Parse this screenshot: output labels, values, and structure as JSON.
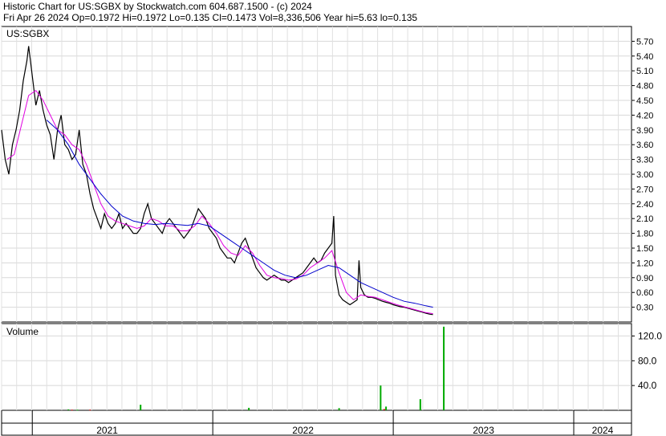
{
  "header": {
    "line1": "Historic Chart for US:SGBX by Stockwatch.com 604.687.1500 - (c) 2024",
    "line2": "Fri Apr 26 2024   Op=0.1972   Hi=0.1972   Lo=0.135   Cl=0.1473   Vol=8,336,506   Year hi=5.63   lo=0.135"
  },
  "chart_data": [
    {
      "type": "line",
      "title": "US:SGBX",
      "price_ticks": [
        5.7,
        5.4,
        5.1,
        4.8,
        4.5,
        4.2,
        3.9,
        3.6,
        3.3,
        3.0,
        2.7,
        2.4,
        2.1,
        1.8,
        1.5,
        1.2,
        0.9,
        0.6,
        0.3
      ],
      "tick_labels": [
        "5.70",
        "5.40",
        "5.10",
        "4.80",
        "4.50",
        "4.20",
        "3.90",
        "3.60",
        "3.30",
        "3.00",
        "2.70",
        "2.40",
        "2.10",
        "1.80",
        "1.50",
        "1.20",
        "0.90",
        "0.60",
        "0.30"
      ],
      "ylim": [
        0.0,
        6.0
      ],
      "x_labels": [
        "2021",
        "2022",
        "2023",
        "2024"
      ],
      "x_range": [
        2020.83,
        2024.32
      ],
      "year_boundaries": [
        2021.0,
        2022.0,
        2023.0,
        2024.0
      ],
      "grid": true,
      "series": [
        {
          "color": "#000000",
          "points": [
            [
              2020.83,
              3.9
            ],
            [
              2020.85,
              3.3
            ],
            [
              2020.87,
              3.0
            ],
            [
              2020.89,
              3.6
            ],
            [
              2020.91,
              3.9
            ],
            [
              2020.93,
              4.3
            ],
            [
              2020.95,
              4.9
            ],
            [
              2020.97,
              5.3
            ],
            [
              2020.98,
              5.6
            ],
            [
              2021.0,
              5.0
            ],
            [
              2021.02,
              4.4
            ],
            [
              2021.04,
              4.7
            ],
            [
              2021.06,
              4.3
            ],
            [
              2021.08,
              4.0
            ],
            [
              2021.1,
              3.8
            ],
            [
              2021.12,
              3.3
            ],
            [
              2021.14,
              3.9
            ],
            [
              2021.16,
              4.2
            ],
            [
              2021.18,
              3.6
            ],
            [
              2021.2,
              3.5
            ],
            [
              2021.22,
              3.3
            ],
            [
              2021.24,
              3.4
            ],
            [
              2021.26,
              3.9
            ],
            [
              2021.28,
              3.2
            ],
            [
              2021.3,
              3.0
            ],
            [
              2021.32,
              2.6
            ],
            [
              2021.34,
              2.3
            ],
            [
              2021.36,
              2.1
            ],
            [
              2021.38,
              1.9
            ],
            [
              2021.4,
              2.2
            ],
            [
              2021.42,
              2.0
            ],
            [
              2021.44,
              1.9
            ],
            [
              2021.46,
              2.0
            ],
            [
              2021.48,
              2.2
            ],
            [
              2021.5,
              1.9
            ],
            [
              2021.52,
              2.0
            ],
            [
              2021.54,
              1.9
            ],
            [
              2021.56,
              1.8
            ],
            [
              2021.58,
              1.8
            ],
            [
              2021.6,
              1.9
            ],
            [
              2021.62,
              2.2
            ],
            [
              2021.64,
              2.4
            ],
            [
              2021.66,
              2.1
            ],
            [
              2021.68,
              2.0
            ],
            [
              2021.7,
              1.9
            ],
            [
              2021.72,
              1.8
            ],
            [
              2021.74,
              2.0
            ],
            [
              2021.76,
              2.1
            ],
            [
              2021.78,
              2.0
            ],
            [
              2021.8,
              1.9
            ],
            [
              2021.82,
              1.8
            ],
            [
              2021.84,
              1.7
            ],
            [
              2021.86,
              1.8
            ],
            [
              2021.88,
              1.9
            ],
            [
              2021.9,
              2.1
            ],
            [
              2021.92,
              2.3
            ],
            [
              2021.94,
              2.2
            ],
            [
              2021.96,
              2.1
            ],
            [
              2021.98,
              1.9
            ],
            [
              2022.0,
              1.8
            ],
            [
              2022.02,
              1.7
            ],
            [
              2022.04,
              1.5
            ],
            [
              2022.06,
              1.4
            ],
            [
              2022.08,
              1.3
            ],
            [
              2022.1,
              1.3
            ],
            [
              2022.12,
              1.2
            ],
            [
              2022.14,
              1.4
            ],
            [
              2022.16,
              1.6
            ],
            [
              2022.18,
              1.7
            ],
            [
              2022.2,
              1.5
            ],
            [
              2022.22,
              1.3
            ],
            [
              2022.24,
              1.1
            ],
            [
              2022.26,
              1.0
            ],
            [
              2022.28,
              0.9
            ],
            [
              2022.3,
              0.85
            ],
            [
              2022.32,
              0.9
            ],
            [
              2022.34,
              0.95
            ],
            [
              2022.36,
              0.9
            ],
            [
              2022.38,
              0.85
            ],
            [
              2022.4,
              0.85
            ],
            [
              2022.42,
              0.8
            ],
            [
              2022.44,
              0.85
            ],
            [
              2022.46,
              0.9
            ],
            [
              2022.48,
              0.95
            ],
            [
              2022.5,
              1.0
            ],
            [
              2022.52,
              1.1
            ],
            [
              2022.54,
              1.2
            ],
            [
              2022.56,
              1.3
            ],
            [
              2022.58,
              1.2
            ],
            [
              2022.6,
              1.25
            ],
            [
              2022.62,
              1.4
            ],
            [
              2022.64,
              1.5
            ],
            [
              2022.66,
              1.6
            ],
            [
              2022.67,
              2.15
            ],
            [
              2022.68,
              0.95
            ],
            [
              2022.7,
              0.55
            ],
            [
              2022.72,
              0.45
            ],
            [
              2022.74,
              0.4
            ],
            [
              2022.76,
              0.35
            ],
            [
              2022.78,
              0.4
            ],
            [
              2022.8,
              0.45
            ],
            [
              2022.81,
              1.25
            ],
            [
              2022.82,
              0.7
            ],
            [
              2022.84,
              0.55
            ],
            [
              2022.86,
              0.5
            ],
            [
              2022.88,
              0.5
            ],
            [
              2022.9,
              0.48
            ],
            [
              2022.92,
              0.45
            ],
            [
              2022.94,
              0.42
            ],
            [
              2022.96,
              0.4
            ],
            [
              2022.98,
              0.38
            ],
            [
              2023.0,
              0.35
            ],
            [
              2023.02,
              0.33
            ],
            [
              2023.04,
              0.31
            ],
            [
              2023.06,
              0.3
            ],
            [
              2023.08,
              0.28
            ],
            [
              2023.1,
              0.26
            ],
            [
              2023.12,
              0.24
            ],
            [
              2023.14,
              0.22
            ],
            [
              2023.16,
              0.2
            ],
            [
              2023.18,
              0.18
            ],
            [
              2023.2,
              0.16
            ],
            [
              2023.22,
              0.15
            ]
          ]
        },
        {
          "color": "#e000e0",
          "points": [
            [
              2020.86,
              3.3
            ],
            [
              2020.9,
              3.4
            ],
            [
              2020.94,
              4.0
            ],
            [
              2020.98,
              4.6
            ],
            [
              2021.02,
              4.7
            ],
            [
              2021.06,
              4.5
            ],
            [
              2021.1,
              4.2
            ],
            [
              2021.14,
              3.9
            ],
            [
              2021.18,
              3.8
            ],
            [
              2021.22,
              3.6
            ],
            [
              2021.26,
              3.5
            ],
            [
              2021.3,
              3.2
            ],
            [
              2021.34,
              2.8
            ],
            [
              2021.38,
              2.4
            ],
            [
              2021.42,
              2.15
            ],
            [
              2021.46,
              2.05
            ],
            [
              2021.5,
              2.0
            ],
            [
              2021.54,
              1.95
            ],
            [
              2021.58,
              1.9
            ],
            [
              2021.62,
              1.95
            ],
            [
              2021.66,
              2.1
            ],
            [
              2021.7,
              2.05
            ],
            [
              2021.74,
              1.95
            ],
            [
              2021.78,
              1.95
            ],
            [
              2021.82,
              1.85
            ],
            [
              2021.86,
              1.85
            ],
            [
              2021.9,
              1.95
            ],
            [
              2021.94,
              2.15
            ],
            [
              2021.98,
              2.0
            ],
            [
              2022.02,
              1.8
            ],
            [
              2022.06,
              1.55
            ],
            [
              2022.1,
              1.4
            ],
            [
              2022.14,
              1.35
            ],
            [
              2022.18,
              1.55
            ],
            [
              2022.22,
              1.4
            ],
            [
              2022.26,
              1.15
            ],
            [
              2022.3,
              0.95
            ],
            [
              2022.34,
              0.9
            ],
            [
              2022.38,
              0.88
            ],
            [
              2022.42,
              0.85
            ],
            [
              2022.46,
              0.87
            ],
            [
              2022.5,
              0.95
            ],
            [
              2022.54,
              1.1
            ],
            [
              2022.58,
              1.2
            ],
            [
              2022.62,
              1.3
            ],
            [
              2022.66,
              1.45
            ],
            [
              2022.7,
              1.0
            ],
            [
              2022.74,
              0.6
            ],
            [
              2022.78,
              0.45
            ],
            [
              2022.82,
              0.55
            ],
            [
              2022.86,
              0.52
            ],
            [
              2022.9,
              0.5
            ],
            [
              2022.94,
              0.45
            ],
            [
              2022.98,
              0.4
            ],
            [
              2023.02,
              0.35
            ],
            [
              2023.06,
              0.31
            ],
            [
              2023.1,
              0.27
            ],
            [
              2023.14,
              0.23
            ],
            [
              2023.18,
              0.19
            ],
            [
              2023.22,
              0.17
            ]
          ]
        },
        {
          "color": "#0000cc",
          "points": [
            [
              2021.08,
              4.1
            ],
            [
              2021.14,
              3.9
            ],
            [
              2021.2,
              3.6
            ],
            [
              2021.26,
              3.2
            ],
            [
              2021.32,
              2.9
            ],
            [
              2021.38,
              2.6
            ],
            [
              2021.44,
              2.35
            ],
            [
              2021.5,
              2.15
            ],
            [
              2021.56,
              2.05
            ],
            [
              2021.62,
              2.0
            ],
            [
              2021.68,
              1.98
            ],
            [
              2021.74,
              2.0
            ],
            [
              2021.8,
              1.98
            ],
            [
              2021.86,
              1.96
            ],
            [
              2021.92,
              2.0
            ],
            [
              2021.98,
              1.95
            ],
            [
              2022.04,
              1.8
            ],
            [
              2022.1,
              1.65
            ],
            [
              2022.16,
              1.5
            ],
            [
              2022.22,
              1.35
            ],
            [
              2022.28,
              1.2
            ],
            [
              2022.34,
              1.05
            ],
            [
              2022.4,
              0.95
            ],
            [
              2022.46,
              0.9
            ],
            [
              2022.52,
              0.95
            ],
            [
              2022.58,
              1.05
            ],
            [
              2022.64,
              1.15
            ],
            [
              2022.7,
              1.1
            ],
            [
              2022.76,
              0.95
            ],
            [
              2022.82,
              0.8
            ],
            [
              2022.88,
              0.7
            ],
            [
              2022.94,
              0.6
            ],
            [
              2023.0,
              0.5
            ],
            [
              2023.06,
              0.42
            ],
            [
              2023.12,
              0.38
            ],
            [
              2023.18,
              0.33
            ],
            [
              2023.22,
              0.3
            ]
          ]
        }
      ]
    },
    {
      "type": "bar",
      "title": "Volume",
      "tick_labels": [
        "120.0",
        "80.0",
        "40.0"
      ],
      "ticks": [
        120,
        80,
        40
      ],
      "ylim": [
        0,
        140
      ],
      "bar_color": "#00aa00",
      "values": [
        [
          2021.2,
          1.5
        ],
        [
          2021.25,
          1.0
        ],
        [
          2021.6,
          9.0
        ],
        [
          2022.2,
          4.0
        ],
        [
          2022.7,
          3.5
        ],
        [
          2022.93,
          40.0
        ],
        [
          2022.96,
          6.0
        ],
        [
          2023.15,
          18.0
        ],
        [
          2023.28,
          135.0
        ]
      ],
      "small_red_bars": [
        [
          2021.22,
          1.0
        ],
        [
          2021.32,
          1.0
        ],
        [
          2022.95,
          2.0
        ]
      ]
    }
  ]
}
